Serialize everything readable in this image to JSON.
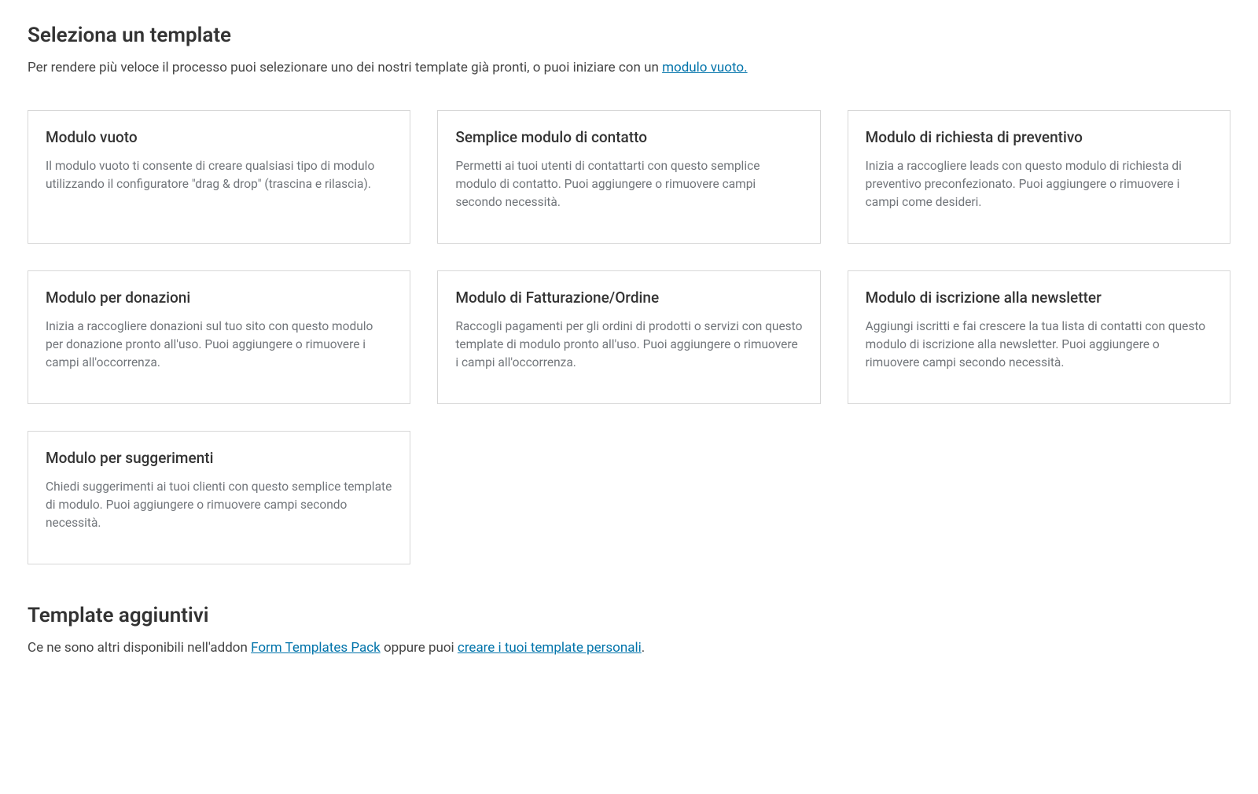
{
  "header": {
    "title": "Seleziona un template",
    "description_pre": "Per rendere più veloce il processo puoi selezionare uno dei nostri template già pronti, o puoi iniziare con un ",
    "link_text": "modulo vuoto."
  },
  "templates": [
    {
      "title": "Modulo vuoto",
      "description": "Il modulo vuoto ti consente di creare qualsiasi tipo di modulo utilizzando il configuratore \"drag & drop\" (trascina e rilascia)."
    },
    {
      "title": "Semplice modulo di contatto",
      "description": "Permetti ai tuoi utenti di contattarti con questo semplice modulo di contatto. Puoi aggiungere o rimuovere campi secondo necessità."
    },
    {
      "title": "Modulo di richiesta di preventivo",
      "description": "Inizia a raccogliere leads con questo modulo di richiesta di preventivo preconfezionato. Puoi aggiungere o rimuovere i campi come desideri."
    },
    {
      "title": "Modulo per donazioni",
      "description": "Inizia a raccogliere donazioni sul tuo sito con questo modulo per donazione pronto all'uso. Puoi aggiungere o rimuovere i campi all'occorrenza."
    },
    {
      "title": "Modulo di Fatturazione/Ordine",
      "description": "Raccogli pagamenti per gli ordini di prodotti o servizi con questo template di modulo pronto all'uso. Puoi aggiungere o rimuovere i campi all'occorrenza."
    },
    {
      "title": "Modulo di iscrizione alla newsletter",
      "description": "Aggiungi iscritti e fai crescere la tua lista di contatti con questo modulo di iscrizione alla newsletter. Puoi aggiungere o rimuovere campi secondo necessità."
    },
    {
      "title": "Modulo per suggerimenti",
      "description": "Chiedi suggerimenti ai tuoi clienti con questo semplice template di modulo. Puoi aggiungere o rimuovere campi secondo necessità."
    }
  ],
  "additional": {
    "title": "Template aggiuntivi",
    "description_pre": "Ce ne sono altri disponibili nell'addon ",
    "link1_text": "Form Templates Pack",
    "description_mid": " oppure puoi ",
    "link2_text": "creare i tuoi template personali",
    "description_post": "."
  }
}
